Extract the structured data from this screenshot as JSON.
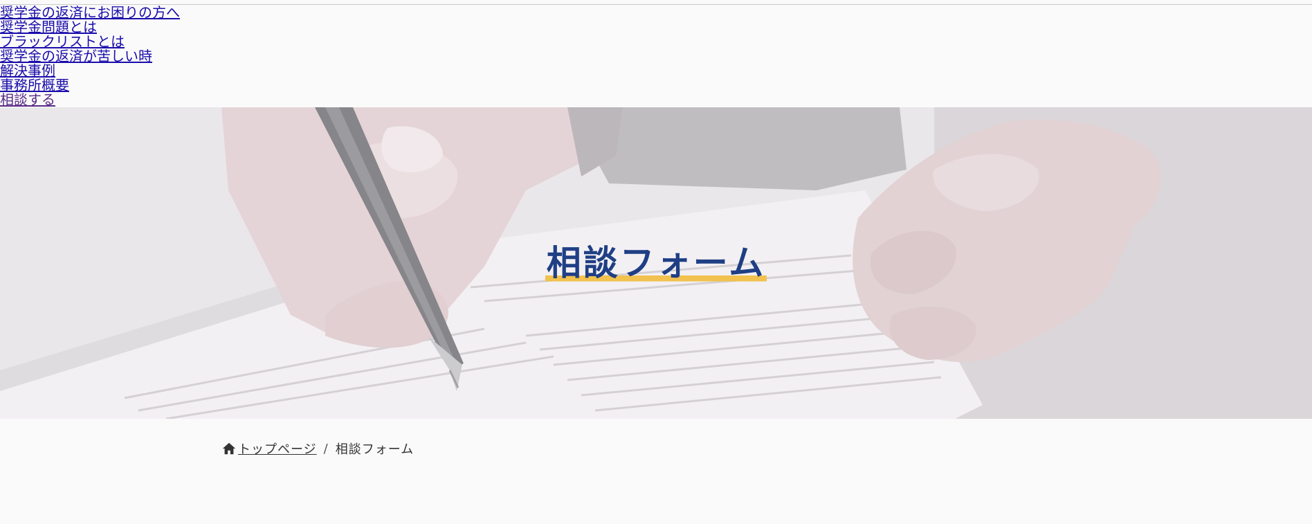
{
  "nav": {
    "items": [
      {
        "label": "奨学金の返済にお困りの方へ"
      },
      {
        "label": "奨学金問題とは"
      },
      {
        "label": "ブラックリストとは"
      },
      {
        "label": "奨学金の返済が苦しい時"
      },
      {
        "label": "解決事例"
      },
      {
        "label": "事務所概要"
      },
      {
        "label": "相談する"
      }
    ]
  },
  "hero": {
    "title": "相談フォーム",
    "background": "hands-signing-document-photo",
    "title_color": "#1f3f85",
    "underline_color": "#f2c14e"
  },
  "breadcrumb": {
    "home_icon": "home-icon",
    "home_label": "トップページ",
    "separator": "/",
    "current": "相談フォーム"
  }
}
